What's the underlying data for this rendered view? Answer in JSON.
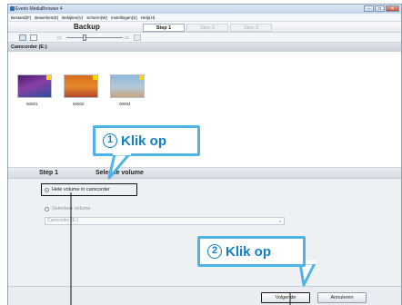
{
  "window": {
    "title": "Everio MediaBrowser 4"
  },
  "window_buttons": {
    "minimize": "–",
    "maximize": "□",
    "close": "✕"
  },
  "menu": [
    "Bestand(F)",
    "Bewerken(E)",
    "Bekijken(V)",
    "Scherm(W)",
    "Instellingen(S)",
    "Help(H)"
  ],
  "stepbar": {
    "mode": "Backup",
    "steps": [
      "Step 1",
      "Step 2",
      "Step 3"
    ],
    "active_step": 0
  },
  "toolbar": {
    "icons": [
      "thumbnail-view-icon",
      "list-view-icon",
      "zoom-slider"
    ]
  },
  "device": {
    "header": "Camcorder (E:)"
  },
  "thumbnails": [
    {
      "label": "00001",
      "icon": "sunset-palm-thumbnail"
    },
    {
      "label": "00002",
      "icon": "airplane-thumbnail"
    },
    {
      "label": "00004",
      "icon": "pyramid-thumbnail"
    }
  ],
  "selection": {
    "step_label": "Step 1",
    "title": "Selectie volume",
    "option_whole": "Hele volume in camcorder",
    "option_select": "Selecteer volume",
    "dropdown_value": "Camcorder (E:)"
  },
  "footer": {
    "next_label": "Volgende",
    "cancel_label": "Annuleren"
  },
  "callouts": [
    {
      "number": "1",
      "text": "Klik op"
    },
    {
      "number": "2",
      "text": "Klik op"
    }
  ],
  "colors": {
    "callout_border": "#4fb3e8",
    "callout_text": "#0f7fc8"
  }
}
